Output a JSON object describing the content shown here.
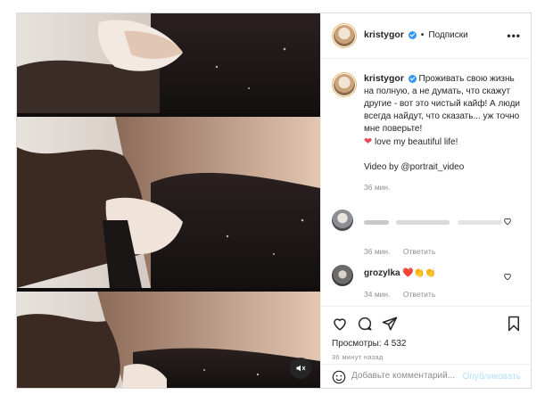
{
  "post": {
    "header": {
      "username": "kristygor",
      "separator": "•",
      "follow_label": "Подписки",
      "more": "•••"
    },
    "caption": {
      "username": "kristygor",
      "text": "Проживать свою жизнь на полную, а не думать, что скажут другие - вот это чистый кайф! А люди всегда найдут, что сказать... уж точно мне поверьте!",
      "love_line": "love my beautiful life!",
      "credit": "Video by @portrait_video",
      "time": "36 мин."
    },
    "comments": [
      {
        "username": "",
        "text": "",
        "time": "36 мин.",
        "reply": "Ответить"
      },
      {
        "username": "grozylka",
        "text": "❤️👏👏",
        "time": "34 мин.",
        "reply": "Ответить"
      }
    ],
    "views": "Просмотры: 4 532",
    "timestamp": "36 минут назад",
    "comment_placeholder": "Добавьте комментарий...",
    "publish_label": "Опубликовать"
  },
  "colors": {
    "accent": "#3897f0",
    "like_red": "#ed4956",
    "publish_disabled": "#b2dffc"
  },
  "icons": [
    "heart-icon",
    "comment-icon",
    "share-icon",
    "bookmark-icon",
    "emoji-icon",
    "mute-icon",
    "more-icon",
    "verified-icon"
  ]
}
